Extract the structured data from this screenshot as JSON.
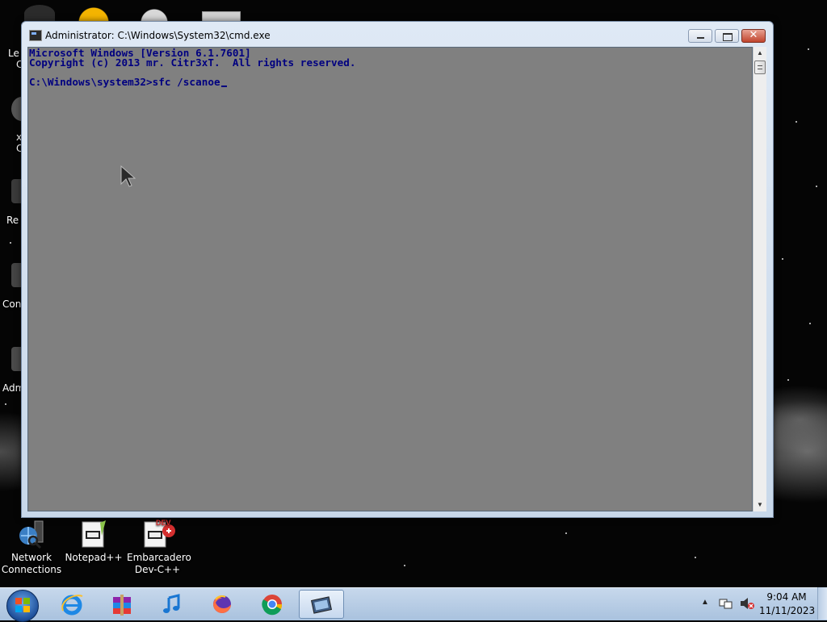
{
  "window": {
    "title": "Administrator: C:\\Windows\\System32\\cmd.exe",
    "close_glyph": "✕"
  },
  "console": {
    "lines": [
      "Microsoft Windows [Version 6.1.7601]",
      "Copyright (c) 2013 mr. Citr3xT.  All rights reserved.",
      "",
      "C:\\Windows\\system32>sfc /scanoe"
    ]
  },
  "desktop": {
    "edge_labels": [
      "Le",
      "C",
      "x",
      "C",
      "Re",
      "Con",
      "Adm"
    ],
    "icons": [
      {
        "label_line1": "Network",
        "label_line2": "Connections",
        "icon": "network-connections-icon"
      },
      {
        "label_line1": "Notepad++",
        "label_line2": "",
        "icon": "notepadpp-icon"
      },
      {
        "label_line1": "Embarcadero",
        "label_line2": "Dev-C++",
        "icon": "devcpp-icon"
      }
    ],
    "devcpp_badge": "DEV"
  },
  "taskbar": {
    "buttons": [
      {
        "name": "internet-explorer",
        "icon": "ie-icon"
      },
      {
        "name": "winrar",
        "icon": "archive-icon"
      },
      {
        "name": "itunes",
        "icon": "music-note-icon"
      },
      {
        "name": "firefox",
        "icon": "firefox-icon"
      },
      {
        "name": "chrome",
        "icon": "chrome-icon"
      },
      {
        "name": "cmd",
        "icon": "cmd-icon",
        "active": true
      }
    ],
    "clock": {
      "time": "9:04 AM",
      "date": "11/11/2023"
    }
  },
  "colors": {
    "console_bg": "#808080",
    "console_text": "#000080",
    "taskbar": "#b9cde4"
  }
}
